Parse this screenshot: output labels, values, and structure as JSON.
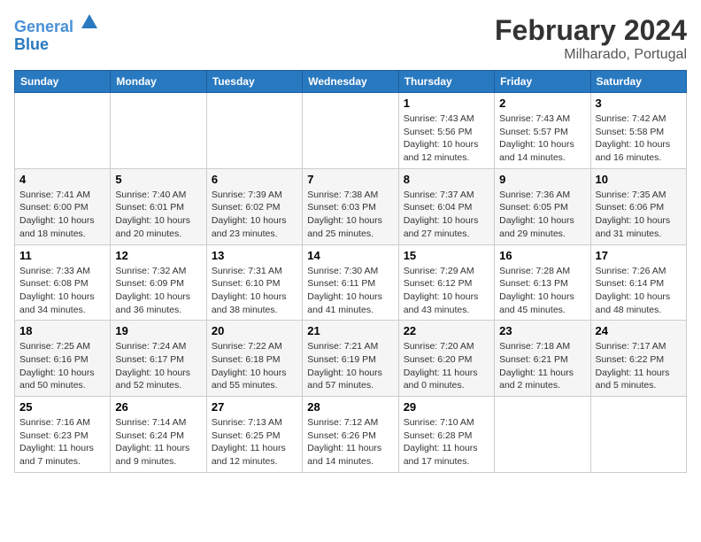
{
  "header": {
    "logo_line1": "General",
    "logo_line2": "Blue",
    "title": "February 2024",
    "subtitle": "Milharado, Portugal"
  },
  "days_of_week": [
    "Sunday",
    "Monday",
    "Tuesday",
    "Wednesday",
    "Thursday",
    "Friday",
    "Saturday"
  ],
  "weeks": [
    [
      {
        "day": "",
        "info": ""
      },
      {
        "day": "",
        "info": ""
      },
      {
        "day": "",
        "info": ""
      },
      {
        "day": "",
        "info": ""
      },
      {
        "day": "1",
        "info": "Sunrise: 7:43 AM\nSunset: 5:56 PM\nDaylight: 10 hours\nand 12 minutes."
      },
      {
        "day": "2",
        "info": "Sunrise: 7:43 AM\nSunset: 5:57 PM\nDaylight: 10 hours\nand 14 minutes."
      },
      {
        "day": "3",
        "info": "Sunrise: 7:42 AM\nSunset: 5:58 PM\nDaylight: 10 hours\nand 16 minutes."
      }
    ],
    [
      {
        "day": "4",
        "info": "Sunrise: 7:41 AM\nSunset: 6:00 PM\nDaylight: 10 hours\nand 18 minutes."
      },
      {
        "day": "5",
        "info": "Sunrise: 7:40 AM\nSunset: 6:01 PM\nDaylight: 10 hours\nand 20 minutes."
      },
      {
        "day": "6",
        "info": "Sunrise: 7:39 AM\nSunset: 6:02 PM\nDaylight: 10 hours\nand 23 minutes."
      },
      {
        "day": "7",
        "info": "Sunrise: 7:38 AM\nSunset: 6:03 PM\nDaylight: 10 hours\nand 25 minutes."
      },
      {
        "day": "8",
        "info": "Sunrise: 7:37 AM\nSunset: 6:04 PM\nDaylight: 10 hours\nand 27 minutes."
      },
      {
        "day": "9",
        "info": "Sunrise: 7:36 AM\nSunset: 6:05 PM\nDaylight: 10 hours\nand 29 minutes."
      },
      {
        "day": "10",
        "info": "Sunrise: 7:35 AM\nSunset: 6:06 PM\nDaylight: 10 hours\nand 31 minutes."
      }
    ],
    [
      {
        "day": "11",
        "info": "Sunrise: 7:33 AM\nSunset: 6:08 PM\nDaylight: 10 hours\nand 34 minutes."
      },
      {
        "day": "12",
        "info": "Sunrise: 7:32 AM\nSunset: 6:09 PM\nDaylight: 10 hours\nand 36 minutes."
      },
      {
        "day": "13",
        "info": "Sunrise: 7:31 AM\nSunset: 6:10 PM\nDaylight: 10 hours\nand 38 minutes."
      },
      {
        "day": "14",
        "info": "Sunrise: 7:30 AM\nSunset: 6:11 PM\nDaylight: 10 hours\nand 41 minutes."
      },
      {
        "day": "15",
        "info": "Sunrise: 7:29 AM\nSunset: 6:12 PM\nDaylight: 10 hours\nand 43 minutes."
      },
      {
        "day": "16",
        "info": "Sunrise: 7:28 AM\nSunset: 6:13 PM\nDaylight: 10 hours\nand 45 minutes."
      },
      {
        "day": "17",
        "info": "Sunrise: 7:26 AM\nSunset: 6:14 PM\nDaylight: 10 hours\nand 48 minutes."
      }
    ],
    [
      {
        "day": "18",
        "info": "Sunrise: 7:25 AM\nSunset: 6:16 PM\nDaylight: 10 hours\nand 50 minutes."
      },
      {
        "day": "19",
        "info": "Sunrise: 7:24 AM\nSunset: 6:17 PM\nDaylight: 10 hours\nand 52 minutes."
      },
      {
        "day": "20",
        "info": "Sunrise: 7:22 AM\nSunset: 6:18 PM\nDaylight: 10 hours\nand 55 minutes."
      },
      {
        "day": "21",
        "info": "Sunrise: 7:21 AM\nSunset: 6:19 PM\nDaylight: 10 hours\nand 57 minutes."
      },
      {
        "day": "22",
        "info": "Sunrise: 7:20 AM\nSunset: 6:20 PM\nDaylight: 11 hours\nand 0 minutes."
      },
      {
        "day": "23",
        "info": "Sunrise: 7:18 AM\nSunset: 6:21 PM\nDaylight: 11 hours\nand 2 minutes."
      },
      {
        "day": "24",
        "info": "Sunrise: 7:17 AM\nSunset: 6:22 PM\nDaylight: 11 hours\nand 5 minutes."
      }
    ],
    [
      {
        "day": "25",
        "info": "Sunrise: 7:16 AM\nSunset: 6:23 PM\nDaylight: 11 hours\nand 7 minutes."
      },
      {
        "day": "26",
        "info": "Sunrise: 7:14 AM\nSunset: 6:24 PM\nDaylight: 11 hours\nand 9 minutes."
      },
      {
        "day": "27",
        "info": "Sunrise: 7:13 AM\nSunset: 6:25 PM\nDaylight: 11 hours\nand 12 minutes."
      },
      {
        "day": "28",
        "info": "Sunrise: 7:12 AM\nSunset: 6:26 PM\nDaylight: 11 hours\nand 14 minutes."
      },
      {
        "day": "29",
        "info": "Sunrise: 7:10 AM\nSunset: 6:28 PM\nDaylight: 11 hours\nand 17 minutes."
      },
      {
        "day": "",
        "info": ""
      },
      {
        "day": "",
        "info": ""
      }
    ]
  ]
}
